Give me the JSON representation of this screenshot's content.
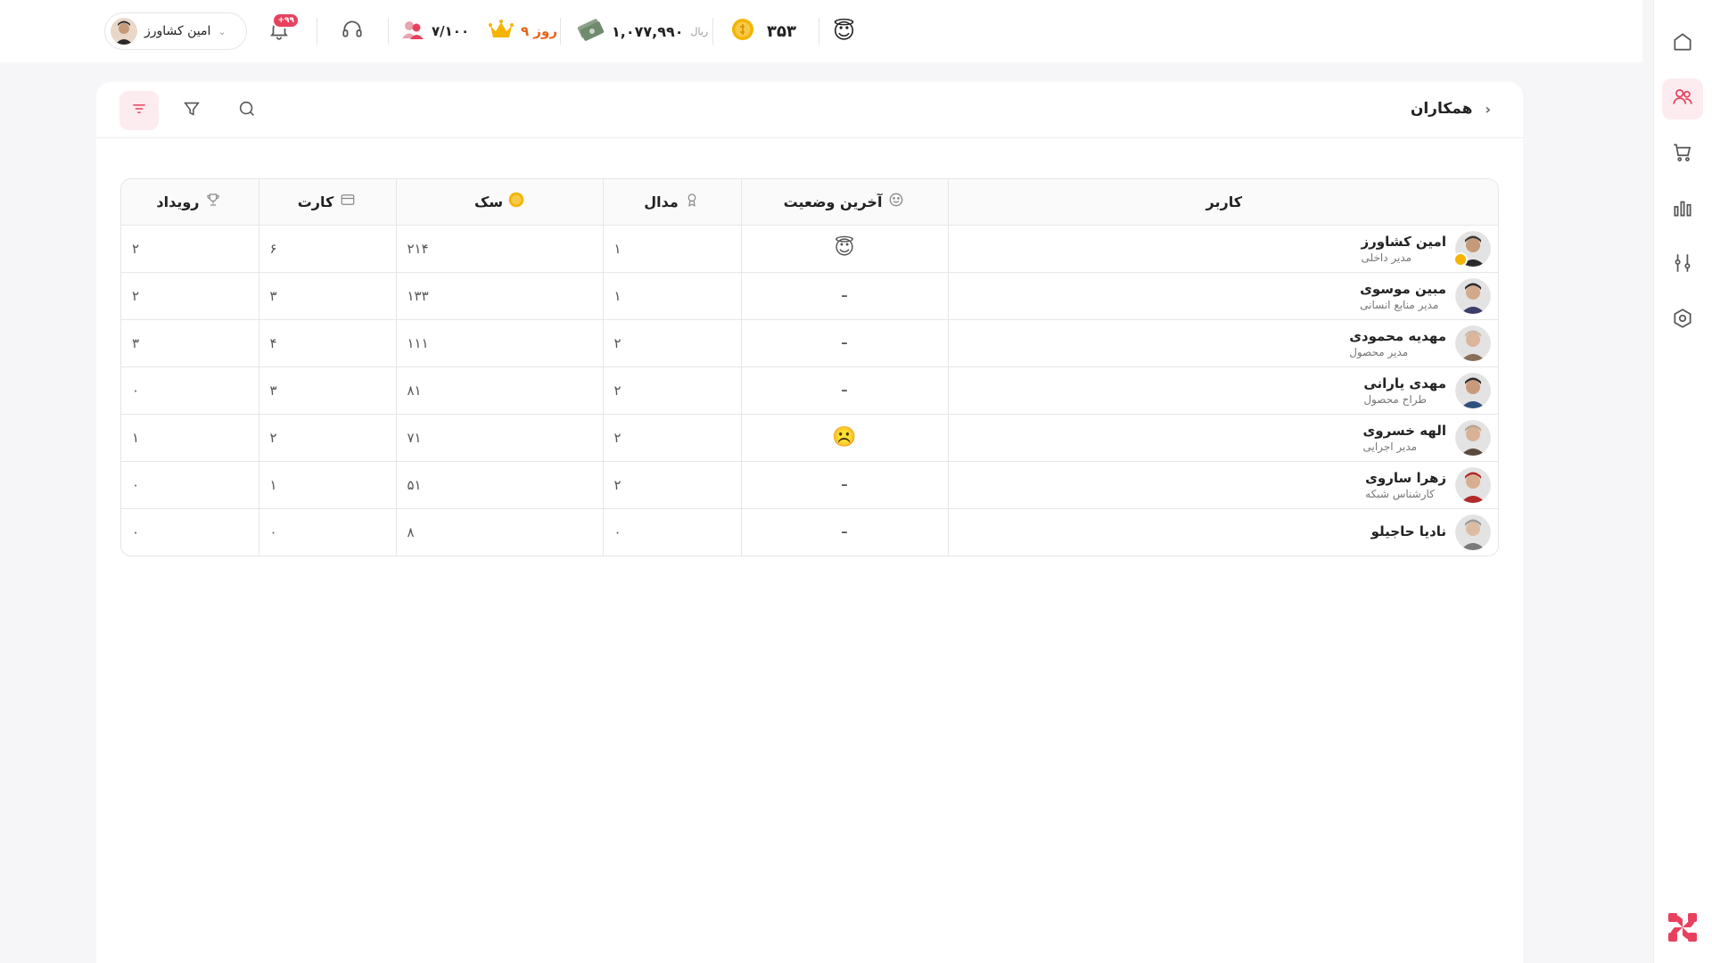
{
  "colors": {
    "accent": "#e8415e",
    "gold": "#f4b400",
    "text": "#222222",
    "muted": "#777777"
  },
  "topbar": {
    "user_name": "امین کشاورز",
    "notifications_badge": "+۹۹",
    "members_count": "۷/۱۰۰",
    "days_label": "۹ روز",
    "money_value": "۱,۰۷۷,۹۹۰",
    "money_unit": "ریال",
    "coins_value": "۳۵۳",
    "status_emoji": "😇"
  },
  "breadcrumb": {
    "title": "همکاران"
  },
  "table": {
    "headers": {
      "user": "کاربر",
      "status": "آخرین وضعیت",
      "medal": "مدال",
      "coin": "سک",
      "card": "کارت",
      "event": "رویداد"
    },
    "rows": [
      {
        "name": "امین کشاورز",
        "role": "مدیر داخلی",
        "status": "😇",
        "medal": "۱",
        "coin": "۲۱۴",
        "card": "۶",
        "event": "۲"
      },
      {
        "name": "مبین موسوی",
        "role": "مدیر منابع انسانی",
        "status": "-",
        "medal": "۱",
        "coin": "۱۳۳",
        "card": "۳",
        "event": "۲"
      },
      {
        "name": "مهدیه محمودی",
        "role": "مدیر محصول",
        "status": "-",
        "medal": "۲",
        "coin": "۱۱۱",
        "card": "۴",
        "event": "۳"
      },
      {
        "name": "مهدی یارانی",
        "role": "طراح محصول",
        "status": "-",
        "medal": "۲",
        "coin": "۸۱",
        "card": "۳",
        "event": "۰"
      },
      {
        "name": "الهه خسروی",
        "role": "مدیر اجرایی",
        "status": "☹️",
        "medal": "۲",
        "coin": "۷۱",
        "card": "۲",
        "event": "۱"
      },
      {
        "name": "زهرا ساروی",
        "role": "کارشناس شبکه",
        "status": "-",
        "medal": "۲",
        "coin": "۵۱",
        "card": "۱",
        "event": "۰"
      },
      {
        "name": "نادیا حاجیلو",
        "role": "",
        "status": "-",
        "medal": "۰",
        "coin": "۸",
        "card": "۰",
        "event": "۰"
      }
    ]
  }
}
